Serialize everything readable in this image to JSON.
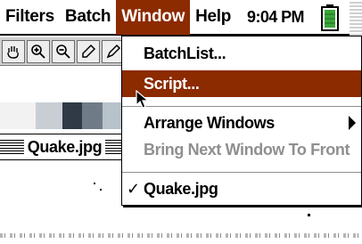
{
  "menubar": {
    "menus": [
      "Filters",
      "Batch",
      "Window",
      "Help"
    ],
    "active_menu": "Window",
    "clock": "9:04 PM"
  },
  "document": {
    "title": "Quake.jpg"
  },
  "window_menu": {
    "items": [
      {
        "label": "BatchList...",
        "state": "normal"
      },
      {
        "label": "Script...",
        "state": "highlighted"
      },
      {
        "label": "Arrange Windows",
        "state": "normal",
        "submenu": true
      },
      {
        "label": "Bring Next Window To Front",
        "state": "disabled"
      },
      {
        "label": "Quake.jpg",
        "state": "checked"
      }
    ],
    "check_mark": "✓"
  },
  "colors": {
    "highlight": "#8c2a00",
    "disabled_text": "#8f8f8f",
    "battery": "#3aa53a"
  }
}
